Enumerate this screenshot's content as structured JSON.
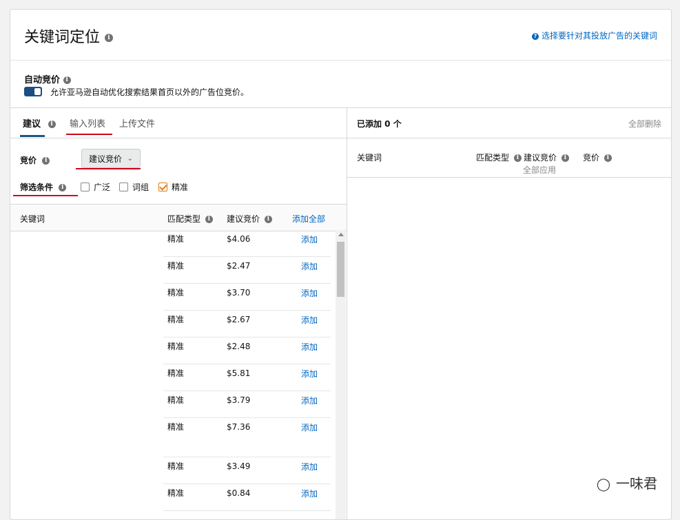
{
  "header": {
    "title": "关键词定位",
    "help_link": "选择要针对其投放广告的关键词"
  },
  "auto_bid": {
    "title": "自动竞价",
    "description": "允许亚马逊自动优化搜索结果首页以外的广告位竞价。",
    "enabled": true
  },
  "left_panel": {
    "tabs": [
      {
        "label": "建议",
        "active": true
      },
      {
        "label": "输入列表",
        "active": false
      },
      {
        "label": "上传文件",
        "active": false
      }
    ],
    "bid_label": "竞价",
    "bid_select": "建议竞价",
    "filter_label": "筛选条件",
    "filters": [
      {
        "label": "广泛",
        "checked": false
      },
      {
        "label": "词组",
        "checked": false
      },
      {
        "label": "精准",
        "checked": true
      }
    ],
    "columns": {
      "keyword": "关键词",
      "match_type": "匹配类型",
      "suggested_bid": "建议竞价",
      "add_all": "添加全部"
    },
    "rows": [
      {
        "match": "精准",
        "bid": "$4.06",
        "action": "添加"
      },
      {
        "match": "精准",
        "bid": "$2.47",
        "action": "添加"
      },
      {
        "match": "精准",
        "bid": "$3.70",
        "action": "添加"
      },
      {
        "match": "精准",
        "bid": "$2.67",
        "action": "添加"
      },
      {
        "match": "精准",
        "bid": "$2.48",
        "action": "添加"
      },
      {
        "match": "精准",
        "bid": "$5.81",
        "action": "添加"
      },
      {
        "match": "精准",
        "bid": "$3.79",
        "action": "添加"
      },
      {
        "match": "精准",
        "bid": "$7.36",
        "action": "添加"
      },
      {
        "match": "精准",
        "bid": "$3.49",
        "action": "添加"
      },
      {
        "match": "精准",
        "bid": "$0.84",
        "action": "添加"
      }
    ]
  },
  "right_panel": {
    "added_label": "已添加 0 个",
    "delete_all": "全部删除",
    "columns": {
      "keyword": "关键词",
      "match_type": "匹配类型",
      "suggested_bid": "建议竞价",
      "apply_all": "全部应用",
      "bid": "竞价"
    }
  },
  "watermark": "一味君",
  "colors": {
    "accent_link": "#0066c0",
    "toggle": "#1d4d84",
    "highlight_underline": "#d0021b",
    "checkbox_checked": "#e47911"
  }
}
